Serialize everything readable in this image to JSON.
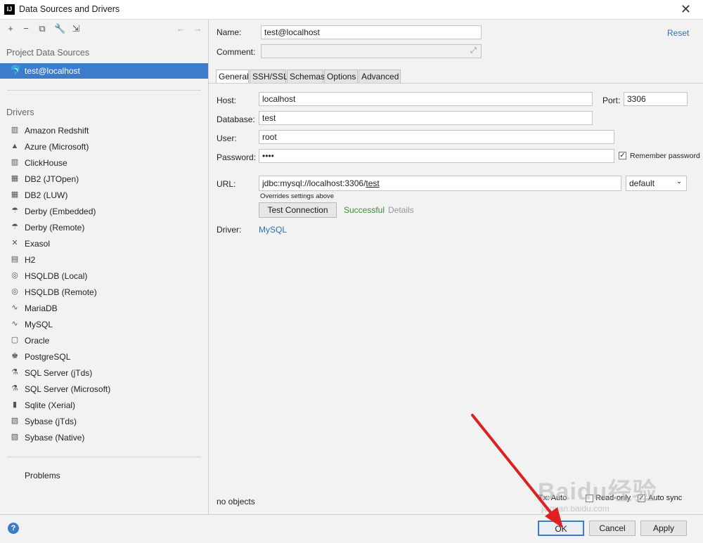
{
  "window": {
    "title": "Data Sources and Drivers"
  },
  "toolbar": {
    "icons": [
      "add-icon",
      "remove-icon",
      "duplicate-icon",
      "wrench-icon",
      "import-icon",
      "back-arrow-icon",
      "forward-arrow-icon"
    ]
  },
  "left": {
    "project_section": "Project Data Sources",
    "selected_source": "test@localhost",
    "drivers_section": "Drivers",
    "drivers": [
      "Amazon Redshift",
      "Azure (Microsoft)",
      "ClickHouse",
      "DB2 (JTOpen)",
      "DB2 (LUW)",
      "Derby (Embedded)",
      "Derby (Remote)",
      "Exasol",
      "H2",
      "HSQLDB (Local)",
      "HSQLDB (Remote)",
      "MariaDB",
      "MySQL",
      "Oracle",
      "PostgreSQL",
      "SQL Server (jTds)",
      "SQL Server (Microsoft)",
      "Sqlite (Xerial)",
      "Sybase (jTds)",
      "Sybase (Native)"
    ],
    "problems": "Problems"
  },
  "form": {
    "name_label": "Name:",
    "name_value": "test@localhost",
    "reset": "Reset",
    "comment_label": "Comment:",
    "comment_value": "",
    "tabs": [
      "General",
      "SSH/SSL",
      "Schemas",
      "Options",
      "Advanced"
    ],
    "host_label": "Host:",
    "host_value": "localhost",
    "port_label": "Port:",
    "port_value": "3306",
    "database_label": "Database:",
    "database_value": "test",
    "user_label": "User:",
    "user_value": "root",
    "password_label": "Password:",
    "password_value": "••••",
    "remember_password": "Remember password",
    "url_label": "URL:",
    "url_value_prefix": "jdbc:mysql://localhost:3306/",
    "url_value_db": "test",
    "url_mode": "default",
    "overrides_note": "Overrides settings above",
    "test_connection": "Test Connection",
    "test_status": "Successful",
    "details": "Details",
    "driver_label": "Driver:",
    "driver_value": "MySQL",
    "objects": "no objects",
    "tx_label": "Tx: Auto",
    "read_only": "Read-only",
    "auto_sync": "Auto sync"
  },
  "footer": {
    "help": "?",
    "ok": "OK",
    "cancel": "Cancel",
    "apply": "Apply"
  },
  "watermark": {
    "text": "Baidu经验",
    "sub": "jingyan.baidu.com"
  },
  "colors": {
    "selection": "#3d7cc9",
    "link": "#2f6fb3",
    "success": "#3a8a3a",
    "annotation_arrow": "#e02020"
  }
}
